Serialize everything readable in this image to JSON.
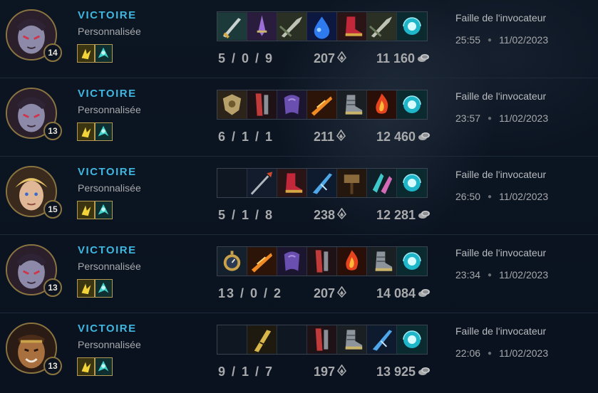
{
  "matches": [
    {
      "result": "VICTOIRE",
      "mode": "Personnalisée",
      "level": "14",
      "champion": "champion-portrait-a",
      "kda": "5 / 0 / 9",
      "cs": "207",
      "gold": "11 160",
      "map": "Faille de l'invocateur",
      "duration": "25:55",
      "date": "11/02/2023",
      "items": [
        "sword-item-icon",
        "violet-blade-item-icon",
        "dagger-item-icon",
        "blue-drop-item-icon",
        "red-boots-item-icon",
        "dagger-item-icon",
        "ward-orb-item-icon"
      ]
    },
    {
      "result": "VICTOIRE",
      "mode": "Personnalisée",
      "level": "13",
      "champion": "champion-portrait-a",
      "kda": "6 / 1 / 1",
      "cs": "211",
      "gold": "12 460",
      "map": "Faille de l'invocateur",
      "duration": "23:57",
      "date": "11/02/2023",
      "items": [
        "gold-shield-item-icon",
        "red-blade-item-icon",
        "purple-cloak-item-icon",
        "flame-blade-item-icon",
        "armored-boots-item-icon",
        "fire-item-icon",
        "ward-orb-item-icon"
      ]
    },
    {
      "result": "VICTOIRE",
      "mode": "Personnalisée",
      "level": "15",
      "champion": "champion-portrait-b",
      "kda": "5 / 1 / 8",
      "cs": "238",
      "gold": "12 281",
      "map": "Faille de l'invocateur",
      "duration": "26:50",
      "date": "11/02/2023",
      "items": [
        "empty-slot",
        "spear-item-icon",
        "red-boots-item-icon",
        "blue-blade-item-icon",
        "hammer-item-icon",
        "teal-crystal-item-icon",
        "ward-orb-item-icon"
      ]
    },
    {
      "result": "VICTOIRE",
      "mode": "Personnalisée",
      "level": "13",
      "champion": "champion-portrait-a",
      "kda": "13 / 0 / 2",
      "cs": "207",
      "gold": "14 084",
      "map": "Faille de l'invocateur",
      "duration": "23:34",
      "date": "11/02/2023",
      "items": [
        "stopwatch-item-icon",
        "flame-blade-item-icon",
        "purple-cloak-item-icon",
        "red-blade-item-icon",
        "fire-item-icon",
        "armored-boots-item-icon",
        "ward-orb-item-icon"
      ]
    },
    {
      "result": "VICTOIRE",
      "mode": "Personnalisée",
      "level": "13",
      "champion": "champion-portrait-c",
      "kda": "9 / 1 / 7",
      "cs": "197",
      "gold": "13 925",
      "map": "Faille de l'invocateur",
      "duration": "22:06",
      "date": "11/02/2023",
      "items": [
        "empty-slot",
        "gold-blade-item-icon",
        "empty-slot",
        "red-blade-item-icon",
        "armored-boots-item-icon",
        "blue-blade-item-icon",
        "ward-orb-item-icon"
      ]
    }
  ]
}
